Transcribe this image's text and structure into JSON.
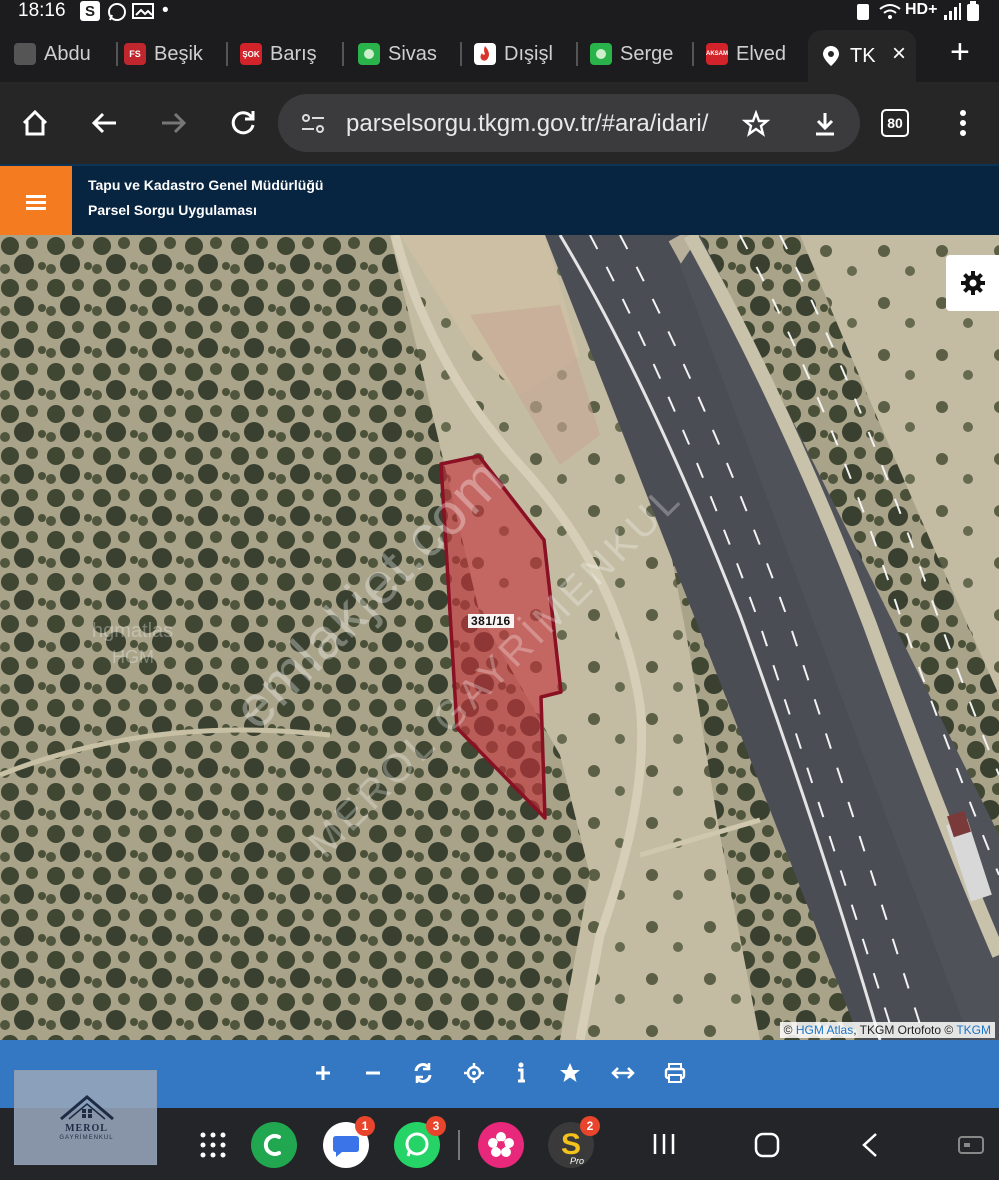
{
  "status_bar": {
    "time": "18:16",
    "notif_icons": [
      "s-icon",
      "whatsapp-icon",
      "image-icon"
    ],
    "dot": "•",
    "network": "HD+"
  },
  "tabs": [
    {
      "label": "Abdu",
      "favicon": "abdu-icon",
      "color": "#555555"
    },
    {
      "label": "Beşik",
      "favicon": "FS",
      "color": "#c0262d"
    },
    {
      "label": "Barış",
      "favicon": "ŞOK",
      "color": "#d2232a"
    },
    {
      "label": "Sivas",
      "favicon": "green-dot-icon",
      "color": "#29b34a"
    },
    {
      "label": "Dışişl",
      "favicon": "flame-icon",
      "color": "#d8352a"
    },
    {
      "label": "Serge",
      "favicon": "green-dot-icon",
      "color": "#29b34a"
    },
    {
      "label": "Elved",
      "favicon": "AKSAM",
      "color": "#d2232a"
    },
    {
      "label": "TK",
      "favicon": "map-pin-icon",
      "color": "#ffffff",
      "active": true
    }
  ],
  "toolbar": {
    "url": "parselsorgu.tkgm.gov.tr/#ara/idari/",
    "tab_count": "80"
  },
  "site_header": {
    "title": "Tapu ve Kadastro Genel Müdürlüğü",
    "subtitle": "Parsel Sorgu Uygulaması"
  },
  "map": {
    "parcel_label": "381/16",
    "parcel_fill": "#c5323a",
    "parcel_stroke": "#8a1024",
    "watermark_1": "emlakjet.com",
    "watermark_2": "MEROL GAYRİMENKUL",
    "tile_watermark": "hgmatlas",
    "tile_watermark_2": "HGM",
    "attribution": {
      "prefix": "© ",
      "hgm": "HGM Atlas",
      "middle": ", TKGM Ortofoto © ",
      "tkgm": "TKGM"
    }
  },
  "map_toolbar": {
    "buttons": [
      "zoom-in-icon",
      "zoom-out-icon",
      "refresh-icon",
      "locate-icon",
      "info-icon",
      "star-icon",
      "measure-icon",
      "print-icon"
    ]
  },
  "logo": {
    "name": "MEROL",
    "sub": "GAYRİMENKUL"
  },
  "navbar": {
    "apps": [
      {
        "name": "apps-grid-icon"
      },
      {
        "name": "phone-app-icon",
        "color": "#21a74f"
      },
      {
        "name": "messages-app-icon",
        "color": "#ffffff",
        "badge": "1"
      },
      {
        "name": "whatsapp-app-icon",
        "color": "#25d366",
        "badge": "3"
      },
      {
        "name": "flower-app-icon",
        "color": "#e8287a"
      },
      {
        "name": "s-pro-app-icon",
        "color": "#3a3a3a",
        "badge": "2",
        "label": "S",
        "sublabel": "Pro"
      }
    ]
  }
}
